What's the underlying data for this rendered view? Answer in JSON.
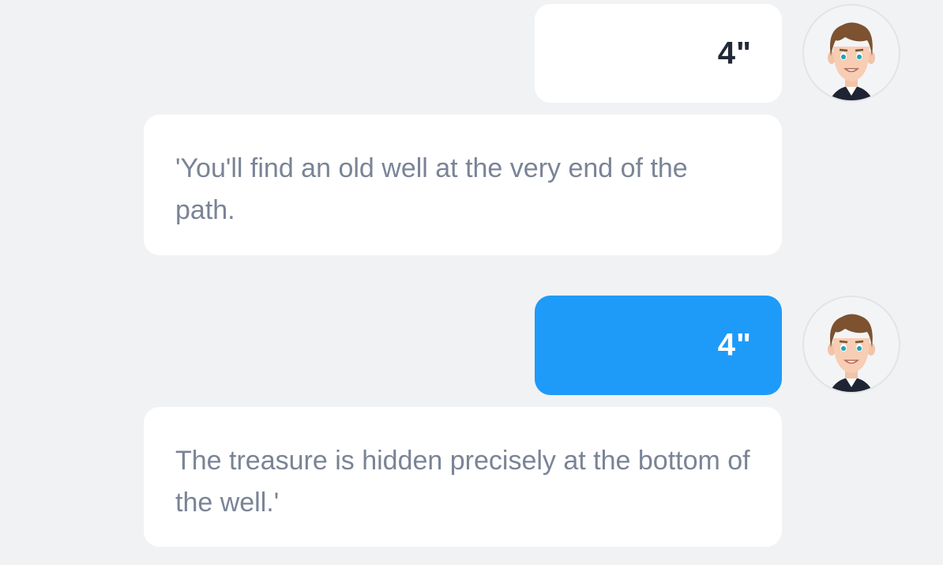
{
  "colors": {
    "page_background": "#f1f2f4",
    "bubble_background": "#ffffff",
    "active_voice_bubble": "#1e9bf8",
    "body_text": "#7a8496",
    "duration_text": "#222a38"
  },
  "messages": [
    {
      "voice_duration": "4\"",
      "voice_state": "idle",
      "avatar_icon": "boy-avatar-icon",
      "transcript": "'You'll find an old well at the very end of the path."
    },
    {
      "voice_duration": "4\"",
      "voice_state": "playing",
      "avatar_icon": "boy-avatar-icon",
      "transcript": "The treasure is hidden precisely at the bottom of the well.'"
    }
  ]
}
